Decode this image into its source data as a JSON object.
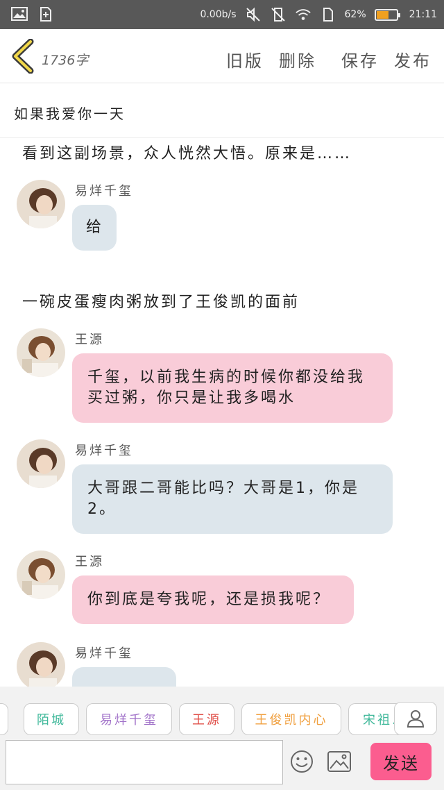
{
  "status_bar": {
    "speed": "0.00b/s",
    "battery_percent": "62%",
    "battery_level": 0.62,
    "time": "21:11",
    "icons": [
      "image-icon",
      "sim-plus-icon",
      "mute-icon",
      "vibrate-icon",
      "wifi-icon",
      "sim-icon"
    ]
  },
  "header": {
    "word_count": "1736字",
    "actions": [
      "旧版",
      "删除",
      "保存",
      "发布"
    ]
  },
  "title": "如果我爱你一天",
  "content": {
    "narration_1": "看到这副场景，众人恍然大悟。原来是……",
    "narration_2": "一碗皮蛋瘦肉粥放到了王俊凯的面前",
    "messages": [
      {
        "name": "易烊千玺",
        "text": "给",
        "color": "blue"
      },
      {
        "name": "王源",
        "text": "千玺，以前我生病的时候你都没给我买过粥，你只是让我多喝水",
        "color": "pink"
      },
      {
        "name": "易烊千玺",
        "text": "大哥跟二哥能比吗？大哥是1，你是2。",
        "color": "blue"
      },
      {
        "name": "王源",
        "text": "你到底是夸我呢，还是损我呢？",
        "color": "pink"
      },
      {
        "name": "易烊千玺",
        "text": "",
        "color": "blue"
      }
    ]
  },
  "tags": [
    {
      "label": "陌城",
      "color": "#3fb89a"
    },
    {
      "label": "易烊千玺",
      "color": "#a070c8"
    },
    {
      "label": "王源",
      "color": "#e0504a"
    },
    {
      "label": "王俊凯内心",
      "color": "#f0a040"
    },
    {
      "label": "宋祖…",
      "color": "#3fb89a"
    }
  ],
  "input": {
    "value": "",
    "placeholder": ""
  },
  "send_label": "发送",
  "colors": {
    "pink_bubble": "#f9ccd8",
    "blue_bubble": "#dde6ec",
    "send_button": "#fb5d8f"
  }
}
